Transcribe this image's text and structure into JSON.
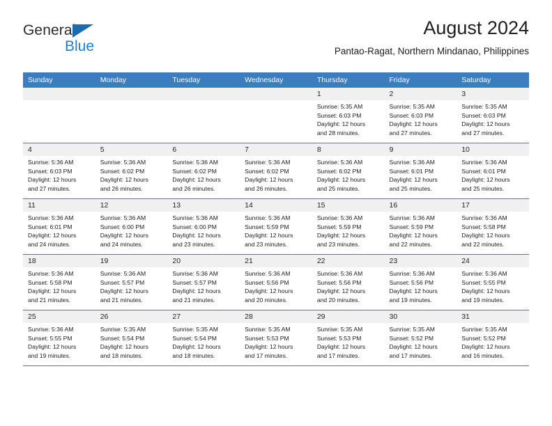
{
  "brand": {
    "name_top": "General",
    "name_bottom": "Blue",
    "accent_color": "#1b7fd4",
    "triangle_color": "#1b6bb0"
  },
  "header": {
    "title": "August 2024",
    "subtitle": "Pantao-Ragat, Northern Mindanao, Philippines"
  },
  "theme": {
    "header_row_bg": "#3b7dbf",
    "header_row_text": "#ffffff",
    "daynum_strip_bg": "#f0f0f0",
    "row_divider": "#3b7dbf"
  },
  "weekday_headers": [
    "Sunday",
    "Monday",
    "Tuesday",
    "Wednesday",
    "Thursday",
    "Friday",
    "Saturday"
  ],
  "weeks": [
    [
      {
        "day": "",
        "sunrise": "",
        "sunset": "",
        "daylight_line1": "",
        "daylight_line2": ""
      },
      {
        "day": "",
        "sunrise": "",
        "sunset": "",
        "daylight_line1": "",
        "daylight_line2": ""
      },
      {
        "day": "",
        "sunrise": "",
        "sunset": "",
        "daylight_line1": "",
        "daylight_line2": ""
      },
      {
        "day": "",
        "sunrise": "",
        "sunset": "",
        "daylight_line1": "",
        "daylight_line2": ""
      },
      {
        "day": "1",
        "sunrise": "Sunrise: 5:35 AM",
        "sunset": "Sunset: 6:03 PM",
        "daylight_line1": "Daylight: 12 hours",
        "daylight_line2": "and 28 minutes."
      },
      {
        "day": "2",
        "sunrise": "Sunrise: 5:35 AM",
        "sunset": "Sunset: 6:03 PM",
        "daylight_line1": "Daylight: 12 hours",
        "daylight_line2": "and 27 minutes."
      },
      {
        "day": "3",
        "sunrise": "Sunrise: 5:35 AM",
        "sunset": "Sunset: 6:03 PM",
        "daylight_line1": "Daylight: 12 hours",
        "daylight_line2": "and 27 minutes."
      }
    ],
    [
      {
        "day": "4",
        "sunrise": "Sunrise: 5:36 AM",
        "sunset": "Sunset: 6:03 PM",
        "daylight_line1": "Daylight: 12 hours",
        "daylight_line2": "and 27 minutes."
      },
      {
        "day": "5",
        "sunrise": "Sunrise: 5:36 AM",
        "sunset": "Sunset: 6:02 PM",
        "daylight_line1": "Daylight: 12 hours",
        "daylight_line2": "and 26 minutes."
      },
      {
        "day": "6",
        "sunrise": "Sunrise: 5:36 AM",
        "sunset": "Sunset: 6:02 PM",
        "daylight_line1": "Daylight: 12 hours",
        "daylight_line2": "and 26 minutes."
      },
      {
        "day": "7",
        "sunrise": "Sunrise: 5:36 AM",
        "sunset": "Sunset: 6:02 PM",
        "daylight_line1": "Daylight: 12 hours",
        "daylight_line2": "and 26 minutes."
      },
      {
        "day": "8",
        "sunrise": "Sunrise: 5:36 AM",
        "sunset": "Sunset: 6:02 PM",
        "daylight_line1": "Daylight: 12 hours",
        "daylight_line2": "and 25 minutes."
      },
      {
        "day": "9",
        "sunrise": "Sunrise: 5:36 AM",
        "sunset": "Sunset: 6:01 PM",
        "daylight_line1": "Daylight: 12 hours",
        "daylight_line2": "and 25 minutes."
      },
      {
        "day": "10",
        "sunrise": "Sunrise: 5:36 AM",
        "sunset": "Sunset: 6:01 PM",
        "daylight_line1": "Daylight: 12 hours",
        "daylight_line2": "and 25 minutes."
      }
    ],
    [
      {
        "day": "11",
        "sunrise": "Sunrise: 5:36 AM",
        "sunset": "Sunset: 6:01 PM",
        "daylight_line1": "Daylight: 12 hours",
        "daylight_line2": "and 24 minutes."
      },
      {
        "day": "12",
        "sunrise": "Sunrise: 5:36 AM",
        "sunset": "Sunset: 6:00 PM",
        "daylight_line1": "Daylight: 12 hours",
        "daylight_line2": "and 24 minutes."
      },
      {
        "day": "13",
        "sunrise": "Sunrise: 5:36 AM",
        "sunset": "Sunset: 6:00 PM",
        "daylight_line1": "Daylight: 12 hours",
        "daylight_line2": "and 23 minutes."
      },
      {
        "day": "14",
        "sunrise": "Sunrise: 5:36 AM",
        "sunset": "Sunset: 5:59 PM",
        "daylight_line1": "Daylight: 12 hours",
        "daylight_line2": "and 23 minutes."
      },
      {
        "day": "15",
        "sunrise": "Sunrise: 5:36 AM",
        "sunset": "Sunset: 5:59 PM",
        "daylight_line1": "Daylight: 12 hours",
        "daylight_line2": "and 23 minutes."
      },
      {
        "day": "16",
        "sunrise": "Sunrise: 5:36 AM",
        "sunset": "Sunset: 5:59 PM",
        "daylight_line1": "Daylight: 12 hours",
        "daylight_line2": "and 22 minutes."
      },
      {
        "day": "17",
        "sunrise": "Sunrise: 5:36 AM",
        "sunset": "Sunset: 5:58 PM",
        "daylight_line1": "Daylight: 12 hours",
        "daylight_line2": "and 22 minutes."
      }
    ],
    [
      {
        "day": "18",
        "sunrise": "Sunrise: 5:36 AM",
        "sunset": "Sunset: 5:58 PM",
        "daylight_line1": "Daylight: 12 hours",
        "daylight_line2": "and 21 minutes."
      },
      {
        "day": "19",
        "sunrise": "Sunrise: 5:36 AM",
        "sunset": "Sunset: 5:57 PM",
        "daylight_line1": "Daylight: 12 hours",
        "daylight_line2": "and 21 minutes."
      },
      {
        "day": "20",
        "sunrise": "Sunrise: 5:36 AM",
        "sunset": "Sunset: 5:57 PM",
        "daylight_line1": "Daylight: 12 hours",
        "daylight_line2": "and 21 minutes."
      },
      {
        "day": "21",
        "sunrise": "Sunrise: 5:36 AM",
        "sunset": "Sunset: 5:56 PM",
        "daylight_line1": "Daylight: 12 hours",
        "daylight_line2": "and 20 minutes."
      },
      {
        "day": "22",
        "sunrise": "Sunrise: 5:36 AM",
        "sunset": "Sunset: 5:56 PM",
        "daylight_line1": "Daylight: 12 hours",
        "daylight_line2": "and 20 minutes."
      },
      {
        "day": "23",
        "sunrise": "Sunrise: 5:36 AM",
        "sunset": "Sunset: 5:56 PM",
        "daylight_line1": "Daylight: 12 hours",
        "daylight_line2": "and 19 minutes."
      },
      {
        "day": "24",
        "sunrise": "Sunrise: 5:36 AM",
        "sunset": "Sunset: 5:55 PM",
        "daylight_line1": "Daylight: 12 hours",
        "daylight_line2": "and 19 minutes."
      }
    ],
    [
      {
        "day": "25",
        "sunrise": "Sunrise: 5:36 AM",
        "sunset": "Sunset: 5:55 PM",
        "daylight_line1": "Daylight: 12 hours",
        "daylight_line2": "and 19 minutes."
      },
      {
        "day": "26",
        "sunrise": "Sunrise: 5:35 AM",
        "sunset": "Sunset: 5:54 PM",
        "daylight_line1": "Daylight: 12 hours",
        "daylight_line2": "and 18 minutes."
      },
      {
        "day": "27",
        "sunrise": "Sunrise: 5:35 AM",
        "sunset": "Sunset: 5:54 PM",
        "daylight_line1": "Daylight: 12 hours",
        "daylight_line2": "and 18 minutes."
      },
      {
        "day": "28",
        "sunrise": "Sunrise: 5:35 AM",
        "sunset": "Sunset: 5:53 PM",
        "daylight_line1": "Daylight: 12 hours",
        "daylight_line2": "and 17 minutes."
      },
      {
        "day": "29",
        "sunrise": "Sunrise: 5:35 AM",
        "sunset": "Sunset: 5:53 PM",
        "daylight_line1": "Daylight: 12 hours",
        "daylight_line2": "and 17 minutes."
      },
      {
        "day": "30",
        "sunrise": "Sunrise: 5:35 AM",
        "sunset": "Sunset: 5:52 PM",
        "daylight_line1": "Daylight: 12 hours",
        "daylight_line2": "and 17 minutes."
      },
      {
        "day": "31",
        "sunrise": "Sunrise: 5:35 AM",
        "sunset": "Sunset: 5:52 PM",
        "daylight_line1": "Daylight: 12 hours",
        "daylight_line2": "and 16 minutes."
      }
    ]
  ]
}
